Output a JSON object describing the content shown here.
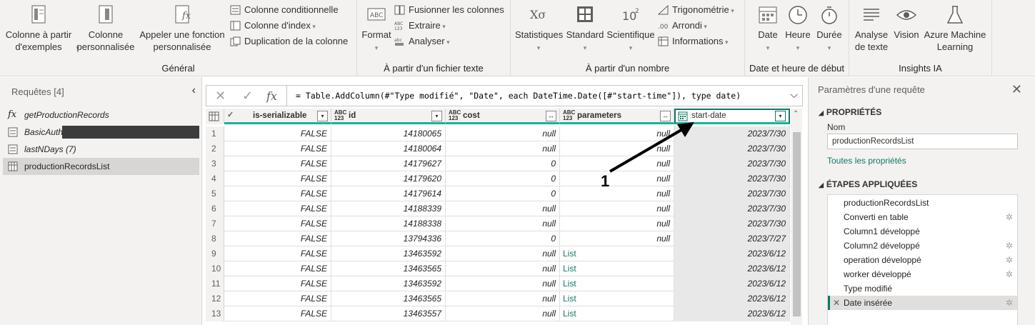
{
  "ribbon": {
    "general": {
      "label": "Général",
      "col_from_examples": "Colonne à partir d'exemples",
      "custom_column": "Colonne personnalisée",
      "invoke_function": "Appeler une fonction personnalisée",
      "conditional_column": "Colonne conditionnelle",
      "index_column": "Colonne d'index",
      "duplicate_column": "Duplication de la colonne"
    },
    "text": {
      "label": "À partir d'un fichier texte",
      "format": "Format",
      "merge_columns": "Fusionner les colonnes",
      "extract": "Extraire",
      "parse": "Analyser"
    },
    "number": {
      "label": "À partir d'un nombre",
      "statistics": "Statistiques",
      "standard": "Standard",
      "scientific": "Scientifique",
      "trigonometry": "Trigonométrie",
      "rounding": "Arrondi",
      "information": "Informations"
    },
    "datetime": {
      "label": "Date et heure de début",
      "date": "Date",
      "time": "Heure",
      "duration": "Durée"
    },
    "ai": {
      "label": "Insights IA",
      "text_analytics": "Analyse de texte",
      "vision": "Vision",
      "azure_ml": "Azure Machine Learning"
    }
  },
  "queries": {
    "title": "Requêtes [4]",
    "items": [
      {
        "label": "getProductionRecords"
      },
      {
        "label": "BasicAuth"
      },
      {
        "label": "lastNDays (7)"
      },
      {
        "label": "productionRecordsList"
      }
    ]
  },
  "formula": {
    "text": "= Table.AddColumn(#\"Type modifié\", \"Date\", each DateTime.Date([#\"start-time\"]), type date)"
  },
  "table": {
    "columns": [
      {
        "type": "",
        "name": "is-serializable"
      },
      {
        "type": "ABC 123",
        "name": "id"
      },
      {
        "type": "ABC 123",
        "name": "cost"
      },
      {
        "type": "ABC 123",
        "name": "parameters"
      },
      {
        "type": "",
        "name": "start-date"
      }
    ],
    "rows": [
      {
        "n": "1",
        "ser": "FALSE",
        "id": "14180065",
        "cost": "null",
        "params": "null",
        "date": "2023/7/30"
      },
      {
        "n": "2",
        "ser": "FALSE",
        "id": "14180064",
        "cost": "null",
        "params": "null",
        "date": "2023/7/30"
      },
      {
        "n": "3",
        "ser": "FALSE",
        "id": "14179627",
        "cost": "0",
        "params": "null",
        "date": "2023/7/30"
      },
      {
        "n": "4",
        "ser": "FALSE",
        "id": "14179620",
        "cost": "0",
        "params": "null",
        "date": "2023/7/30"
      },
      {
        "n": "5",
        "ser": "FALSE",
        "id": "14179614",
        "cost": "0",
        "params": "null",
        "date": "2023/7/30"
      },
      {
        "n": "6",
        "ser": "FALSE",
        "id": "14188339",
        "cost": "null",
        "params": "null",
        "date": "2023/7/30"
      },
      {
        "n": "7",
        "ser": "FALSE",
        "id": "14188338",
        "cost": "null",
        "params": "null",
        "date": "2023/7/30"
      },
      {
        "n": "8",
        "ser": "FALSE",
        "id": "13794336",
        "cost": "0",
        "params": "null",
        "date": "2023/7/27"
      },
      {
        "n": "9",
        "ser": "FALSE",
        "id": "13463592",
        "cost": "null",
        "params": "List",
        "date": "2023/6/12"
      },
      {
        "n": "10",
        "ser": "FALSE",
        "id": "13463565",
        "cost": "null",
        "params": "List",
        "date": "2023/6/12"
      },
      {
        "n": "11",
        "ser": "FALSE",
        "id": "13463592",
        "cost": "null",
        "params": "List",
        "date": "2023/6/12"
      },
      {
        "n": "12",
        "ser": "FALSE",
        "id": "13463565",
        "cost": "null",
        "params": "List",
        "date": "2023/6/12"
      },
      {
        "n": "13",
        "ser": "FALSE",
        "id": "13463557",
        "cost": "null",
        "params": "List",
        "date": "2023/6/12"
      }
    ]
  },
  "annotation": {
    "label": "1"
  },
  "settings": {
    "title": "Paramètres d'une requête",
    "properties_label": "PROPRIÉTÉS",
    "name_label": "Nom",
    "name_value": "productionRecordsList",
    "all_properties": "Toutes les propriétés",
    "applied_steps_label": "ÉTAPES APPLIQUÉES",
    "steps": [
      {
        "label": "productionRecordsList",
        "gear": false
      },
      {
        "label": "Converti en table",
        "gear": true
      },
      {
        "label": "Column1 développé",
        "gear": false
      },
      {
        "label": "Column2 développé",
        "gear": true
      },
      {
        "label": "operation développé",
        "gear": true
      },
      {
        "label": "worker développé",
        "gear": true
      },
      {
        "label": "Type modifié",
        "gear": false
      },
      {
        "label": "Date insérée",
        "gear": true
      }
    ]
  },
  "colors": {
    "accent": "#117865",
    "header_underline": "#17b398"
  }
}
